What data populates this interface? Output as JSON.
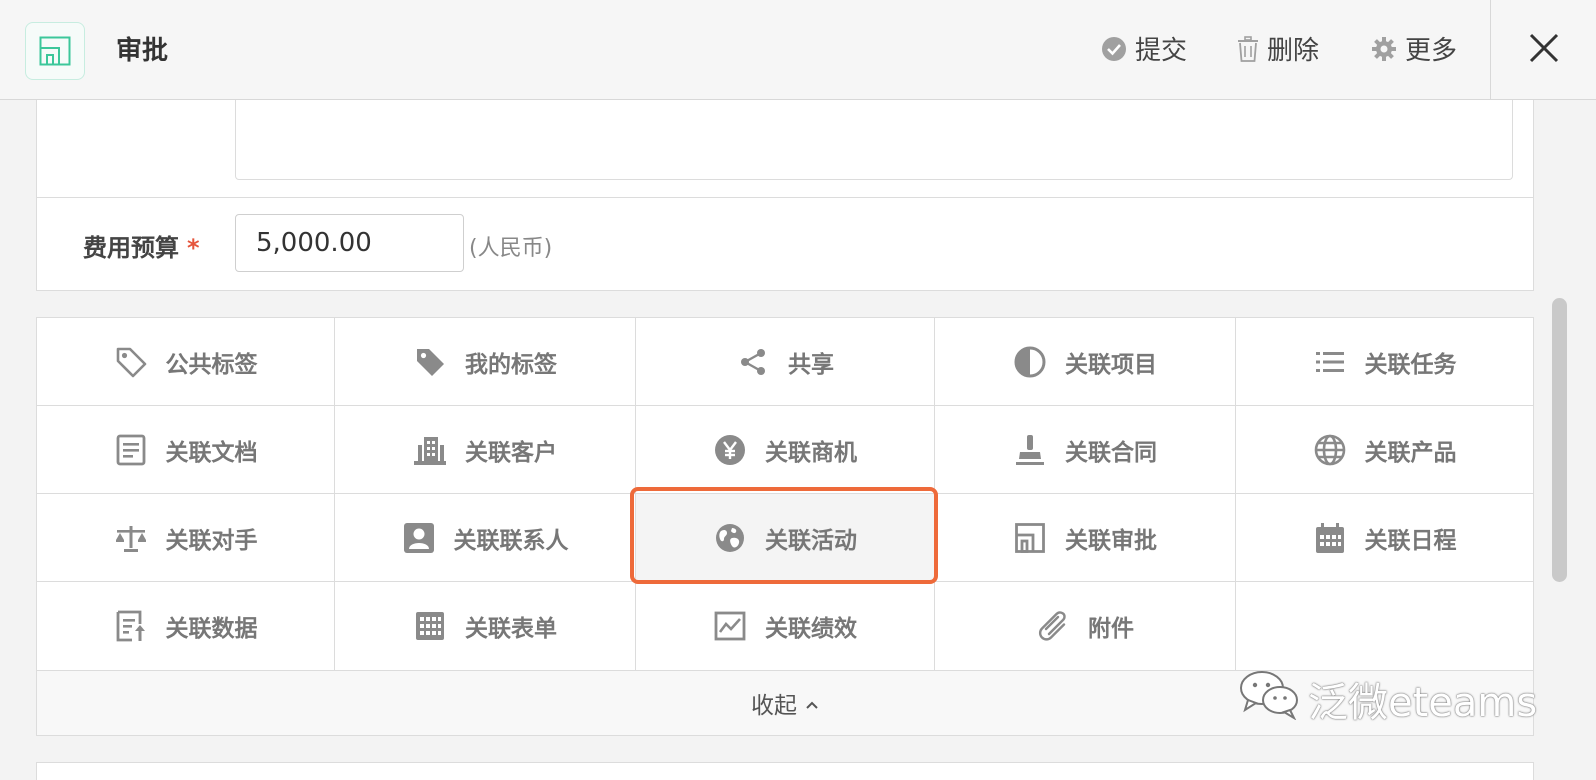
{
  "header": {
    "title": "审批",
    "submit_label": "提交",
    "delete_label": "删除",
    "more_label": "更多"
  },
  "form": {
    "budget_label": "费用预算",
    "required_mark": "*",
    "budget_value": "5,000.00",
    "budget_unit": "(人民币)"
  },
  "relations": [
    {
      "label": "公共标签",
      "icon": "tag-icon"
    },
    {
      "label": "我的标签",
      "icon": "tag-filled-icon"
    },
    {
      "label": "共享",
      "icon": "share-icon"
    },
    {
      "label": "关联项目",
      "icon": "half-circle-icon"
    },
    {
      "label": "关联任务",
      "icon": "list-icon"
    },
    {
      "label": "关联文档",
      "icon": "document-icon"
    },
    {
      "label": "关联客户",
      "icon": "building-icon"
    },
    {
      "label": "关联商机",
      "icon": "yen-circle-icon"
    },
    {
      "label": "关联合同",
      "icon": "stamp-icon"
    },
    {
      "label": "关联产品",
      "icon": "globe-icon"
    },
    {
      "label": "关联对手",
      "icon": "scale-icon"
    },
    {
      "label": "关联联系人",
      "icon": "contact-icon"
    },
    {
      "label": "关联活动",
      "icon": "earth-icon"
    },
    {
      "label": "关联审批",
      "icon": "approval-icon"
    },
    {
      "label": "关联日程",
      "icon": "calendar-icon"
    },
    {
      "label": "关联数据",
      "icon": "data-report-icon"
    },
    {
      "label": "关联表单",
      "icon": "table-grid-icon"
    },
    {
      "label": "关联绩效",
      "icon": "performance-chart-icon"
    },
    {
      "label": "附件",
      "icon": "paperclip-icon"
    },
    {
      "label": "",
      "icon": ""
    }
  ],
  "collapse_label": "收起",
  "watermark_text": "泛微eteams",
  "colors": {
    "accent": "#ee6a3a",
    "required": "#e5553c",
    "app_icon": "#3cc79a"
  }
}
